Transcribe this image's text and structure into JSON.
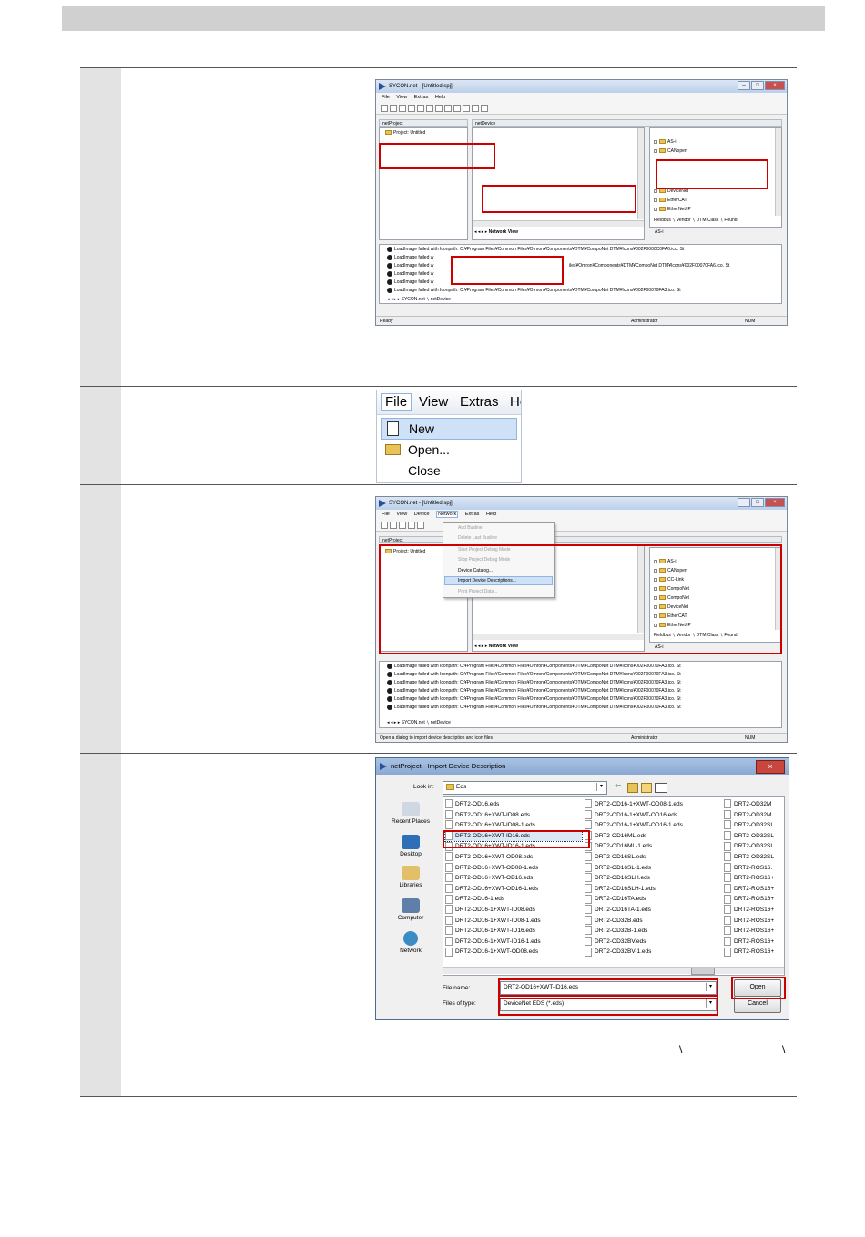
{
  "step1": {
    "window_title": "SYCON.net - [Untitled.spj]",
    "menu": [
      "File",
      "View",
      "Extras",
      "Help"
    ],
    "project_pane_header": "netProject",
    "project_root": "Project: Untitled",
    "device_pane_header": "netDevice",
    "catalog_items": [
      "AS-i",
      "CANopen",
      "DeviceNet",
      "EtherCAT",
      "EtherNet/IP"
    ],
    "catalog_tabs": "Fieldbus ∖ Vendor ∖ DTM Class ∖ Found",
    "catalog_footer": "AS-i",
    "network_view_tab": "Network View",
    "log_lines": [
      "LoadImage failed with Iconpath: C:¥Program Files¥Common Files¥Omron¥Components¥DTM¥CompoNet DTM¥Icons¥002F0000C0FA6.ico. St",
      "LoadImage failed w",
      "LoadImage failed w",
      "LoadImage failed w",
      "LoadImage failed w",
      "LoadImage failed with Iconpath: C:¥Program Files¥Common Files¥Omron¥Components¥DTM¥CompoNet DTM¥Icons¥002F00070FA3.ico. St"
    ],
    "log_tail": "iles¥Omron¥Components¥DTM¥CompoNet DTM¥Icons¥002F00070FA6.ico. St",
    "output_tabs": "SYCON.net ∖ netDevice",
    "status_left": "Ready",
    "status_user": "Administrator",
    "status_num": "NUM"
  },
  "step2": {
    "menu": [
      "File",
      "View",
      "Extras",
      "He"
    ],
    "items": [
      "New",
      "Open...",
      "Close"
    ]
  },
  "step3": {
    "window_title": "SYCON.net - [Untitled.spj]",
    "menu": [
      "File",
      "View",
      "Device",
      "Network",
      "Extras",
      "Help"
    ],
    "project_pane_header": "netProject",
    "project_root": "Project: Untitled",
    "network_menu_items": [
      "Add Busline",
      "Delete Last Busline",
      "Start Project Debug Mode",
      "Stop Project Debug Mode",
      "Device Catalog...",
      "Import Device Descriptions...",
      "Print Project Data..."
    ],
    "catalog_items": [
      "AS-i",
      "CANopen",
      "CC-Link",
      "CompoNet",
      "CompoNet",
      "DeviceNet",
      "EtherCAT",
      "EtherNet/IP"
    ],
    "catalog_tabs": "Fieldbus ∖ Vendor ∖ DTM Class ∖ Found",
    "catalog_footer": "AS-i",
    "network_view_tab": "Network View",
    "log_line": "LoadImage failed with Iconpath: C:¥Program Files¥Common Files¥Omron¥Components¥DTM¥CompoNet DTM¥Icons¥002F00070FA3.ico. St",
    "output_tabs": "SYCON.net ∖ netDevice",
    "status_left": "Open a dialog to import device description and icon files",
    "status_user": "Administrator",
    "status_num": "NUM"
  },
  "step4": {
    "dialog_title": "netProject - Import Device Description",
    "look_in_label": "Look in:",
    "look_in_value": "Eds",
    "places": [
      "Recent Places",
      "Desktop",
      "Libraries",
      "Computer",
      "Network"
    ],
    "col1": [
      "DRT2-OD16.eds",
      "DRT2-OD16+XWT-ID08.eds",
      "DRT2-OD16+XWT-ID08-1.eds",
      "DRT2-OD16+XWT-ID16.eds",
      "DRT2-OD16+XWT-ID16-1.eds",
      "DRT2-OD16+XWT-OD08.eds",
      "DRT2-OD16+XWT-OD08-1.eds",
      "DRT2-OD16+XWT-OD16.eds",
      "DRT2-OD16+XWT-OD16-1.eds",
      "DRT2-OD16-1.eds",
      "DRT2-OD16-1+XWT-ID08.eds",
      "DRT2-OD16-1+XWT-ID08-1.eds",
      "DRT2-OD16-1+XWT-ID16.eds",
      "DRT2-OD16-1+XWT-ID16-1.eds",
      "DRT2-OD16-1+XWT-OD08.eds"
    ],
    "col2": [
      "DRT2-OD16-1+XWT-OD08-1.eds",
      "DRT2-OD16-1+XWT-OD16.eds",
      "DRT2-OD16-1+XWT-OD16-1.eds",
      "DRT2-OD16ML.eds",
      "DRT2-OD16ML-1.eds",
      "DRT2-OD16SL.eds",
      "DRT2-OD16SL-1.eds",
      "DRT2-OD16SLH.eds",
      "DRT2-OD16SLH-1.eds",
      "DRT2-OD16TA.eds",
      "DRT2-OD16TA-1.eds",
      "DRT2-OD32B.eds",
      "DRT2-OD32B-1.eds",
      "DRT2-OD32BV.eds",
      "DRT2-OD32BV-1.eds"
    ],
    "col3": [
      "DRT2-OD32M",
      "DRT2-OD32M",
      "DRT2-OD32SL",
      "DRT2-OD32SL",
      "DRT2-OD32SL",
      "DRT2-OD32SL",
      "DRT2-ROS16.",
      "DRT2-ROS16+",
      "DRT2-ROS16+",
      "DRT2-ROS16+",
      "DRT2-ROS16+",
      "DRT2-ROS16+",
      "DRT2-ROS16+",
      "DRT2-ROS16+",
      "DRT2-ROS16+"
    ],
    "selected_index": 3,
    "file_name_label": "File name:",
    "file_name_value": "DRT2-OD16+XWT-ID16.eds",
    "files_type_label": "Files of type:",
    "files_type_value": "DeviceNet EDS (*.eds)",
    "open_label": "Open",
    "cancel_label": "Cancel"
  },
  "step4_note": [
    "\\",
    "\\"
  ]
}
